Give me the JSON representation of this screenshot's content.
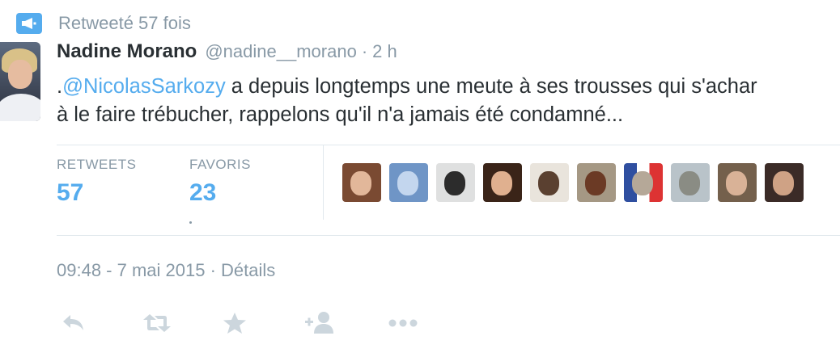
{
  "retweet_context": {
    "text": "Retweeté 57 fois",
    "icon": "megaphone-icon",
    "icon_color": "#55acee"
  },
  "author": {
    "name": "Nadine Morano",
    "handle": "@nadine__morano",
    "separator": "·",
    "time": "2 h"
  },
  "tweet": {
    "prefix": ".",
    "mention": "@NicolasSarkozy",
    "line1_rest": " a depuis longtemps une meute à ses trousses qui s'achar",
    "line2": "à le faire trébucher, rappelons qu'il n'a jamais été condamné..."
  },
  "stats": {
    "retweets_label": "RETWEETS",
    "retweets_value": "57",
    "favorites_label": "FAVORIS",
    "favorites_value": "23"
  },
  "timestamp": {
    "time": "09:48 - 7 mai 2015",
    "separator": "·",
    "details_link": "Détails"
  },
  "actions": [
    "reply-icon",
    "retweet-icon",
    "favorite-icon",
    "follow-icon",
    "more-icon"
  ],
  "colors": {
    "accent": "#55acee",
    "muted": "#8899a6",
    "text": "#292f33",
    "divider": "#e1e8ed",
    "icon": "#ccd6dd"
  }
}
